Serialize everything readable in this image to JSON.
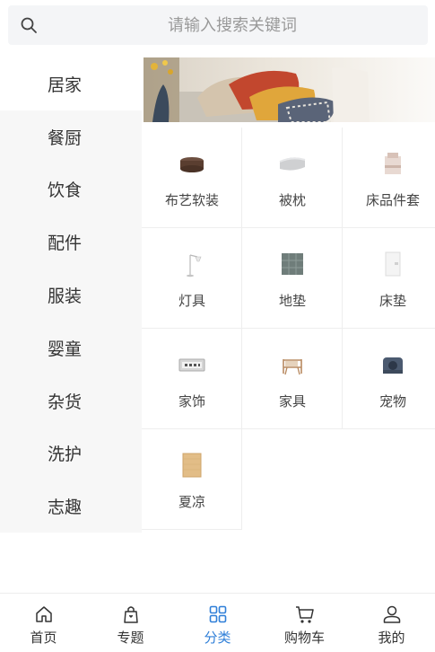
{
  "search": {
    "placeholder": "请输入搜索关键词"
  },
  "sidebar": {
    "items": [
      {
        "label": "居家",
        "active": true
      },
      {
        "label": "餐厨"
      },
      {
        "label": "饮食"
      },
      {
        "label": "配件"
      },
      {
        "label": "服装"
      },
      {
        "label": "婴童"
      },
      {
        "label": "杂货"
      },
      {
        "label": "洗护"
      },
      {
        "label": "志趣"
      }
    ]
  },
  "grid": {
    "items": [
      {
        "label": "布艺软装",
        "icon": "fabric-ottoman-icon"
      },
      {
        "label": "被枕",
        "icon": "pillow-icon"
      },
      {
        "label": "床品件套",
        "icon": "bedding-set-icon"
      },
      {
        "label": "灯具",
        "icon": "floor-lamp-icon"
      },
      {
        "label": "地垫",
        "icon": "floor-mat-icon"
      },
      {
        "label": "床垫",
        "icon": "mattress-icon"
      },
      {
        "label": "家饰",
        "icon": "decor-clock-icon"
      },
      {
        "label": "家具",
        "icon": "chair-icon"
      },
      {
        "label": "宠物",
        "icon": "pet-bed-icon"
      },
      {
        "label": "夏凉",
        "icon": "summer-mat-icon"
      }
    ]
  },
  "tabbar": {
    "items": [
      {
        "label": "首页",
        "icon": "home-icon"
      },
      {
        "label": "专题",
        "icon": "topic-bag-icon"
      },
      {
        "label": "分类",
        "icon": "category-grid-icon",
        "active": true
      },
      {
        "label": "购物车",
        "icon": "cart-icon"
      },
      {
        "label": "我的",
        "icon": "profile-icon"
      }
    ]
  },
  "colors": {
    "accent": "#2f7fd8",
    "sidebar_bg": "#f7f7f7",
    "search_bg": "#f4f5f7"
  }
}
